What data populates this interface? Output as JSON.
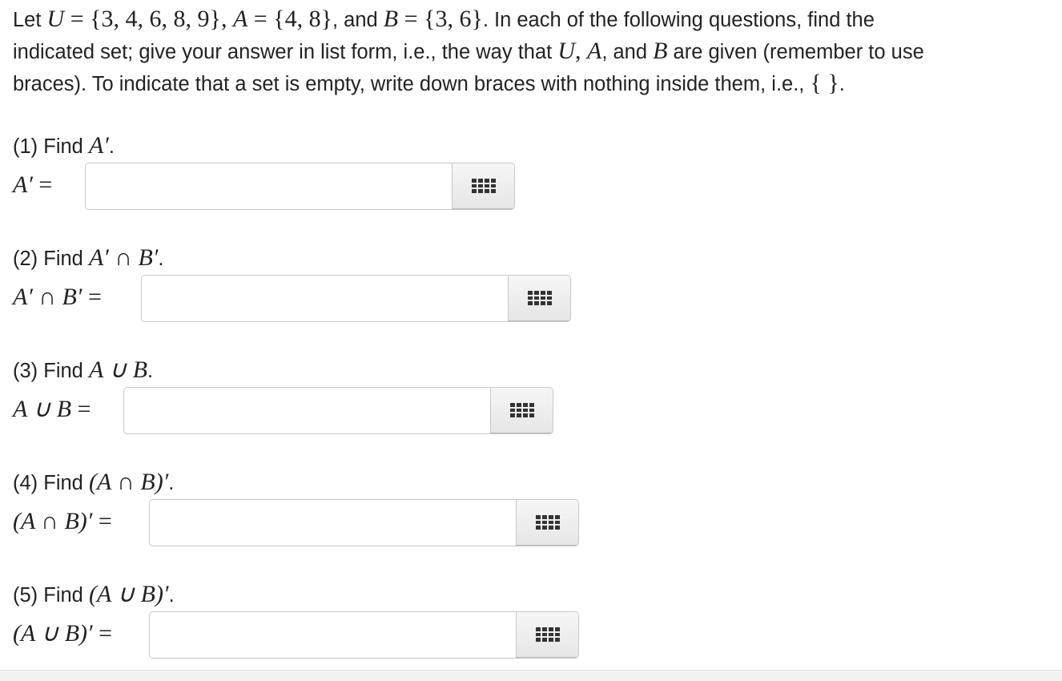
{
  "intro": {
    "line1": [
      "Let ",
      "U",
      " = {3, 4, 6, 8, 9}",
      ", ",
      "A",
      " = {4, 8}",
      ", and ",
      "B",
      " = {3, 6}",
      ". In each of the following questions, find the"
    ],
    "line2": [
      "indicated set; give your answer in list form, i.e., the way that ",
      "U",
      ", ",
      "A",
      ", and ",
      "B",
      " are given (remember to use"
    ],
    "line3": [
      "braces). To indicate that a set is empty, write down braces with nothing inside them, i.e., ",
      "{ }",
      "."
    ]
  },
  "questions": [
    {
      "prompt": [
        "(1) Find ",
        "A′",
        "."
      ],
      "label": [
        "A′",
        " = "
      ],
      "value": ""
    },
    {
      "prompt": [
        "(2) Find ",
        "A′ ∩ B′",
        "."
      ],
      "label": [
        "A′ ∩ B′",
        " = "
      ],
      "value": ""
    },
    {
      "prompt": [
        "(3) Find ",
        "A ∪ B",
        "."
      ],
      "label": [
        "A ∪ B",
        " = "
      ],
      "value": ""
    },
    {
      "prompt": [
        "(4) Find ",
        "(A ∩ B)′",
        "."
      ],
      "label": [
        "(A ∩ B)′",
        " = "
      ],
      "value": ""
    },
    {
      "prompt": [
        "(5) Find ",
        "(A ∪ B)′",
        "."
      ],
      "label": [
        "(A ∪ B)′",
        " = "
      ],
      "value": ""
    }
  ],
  "icons": {
    "keypad": "keypad-grid-icon"
  }
}
